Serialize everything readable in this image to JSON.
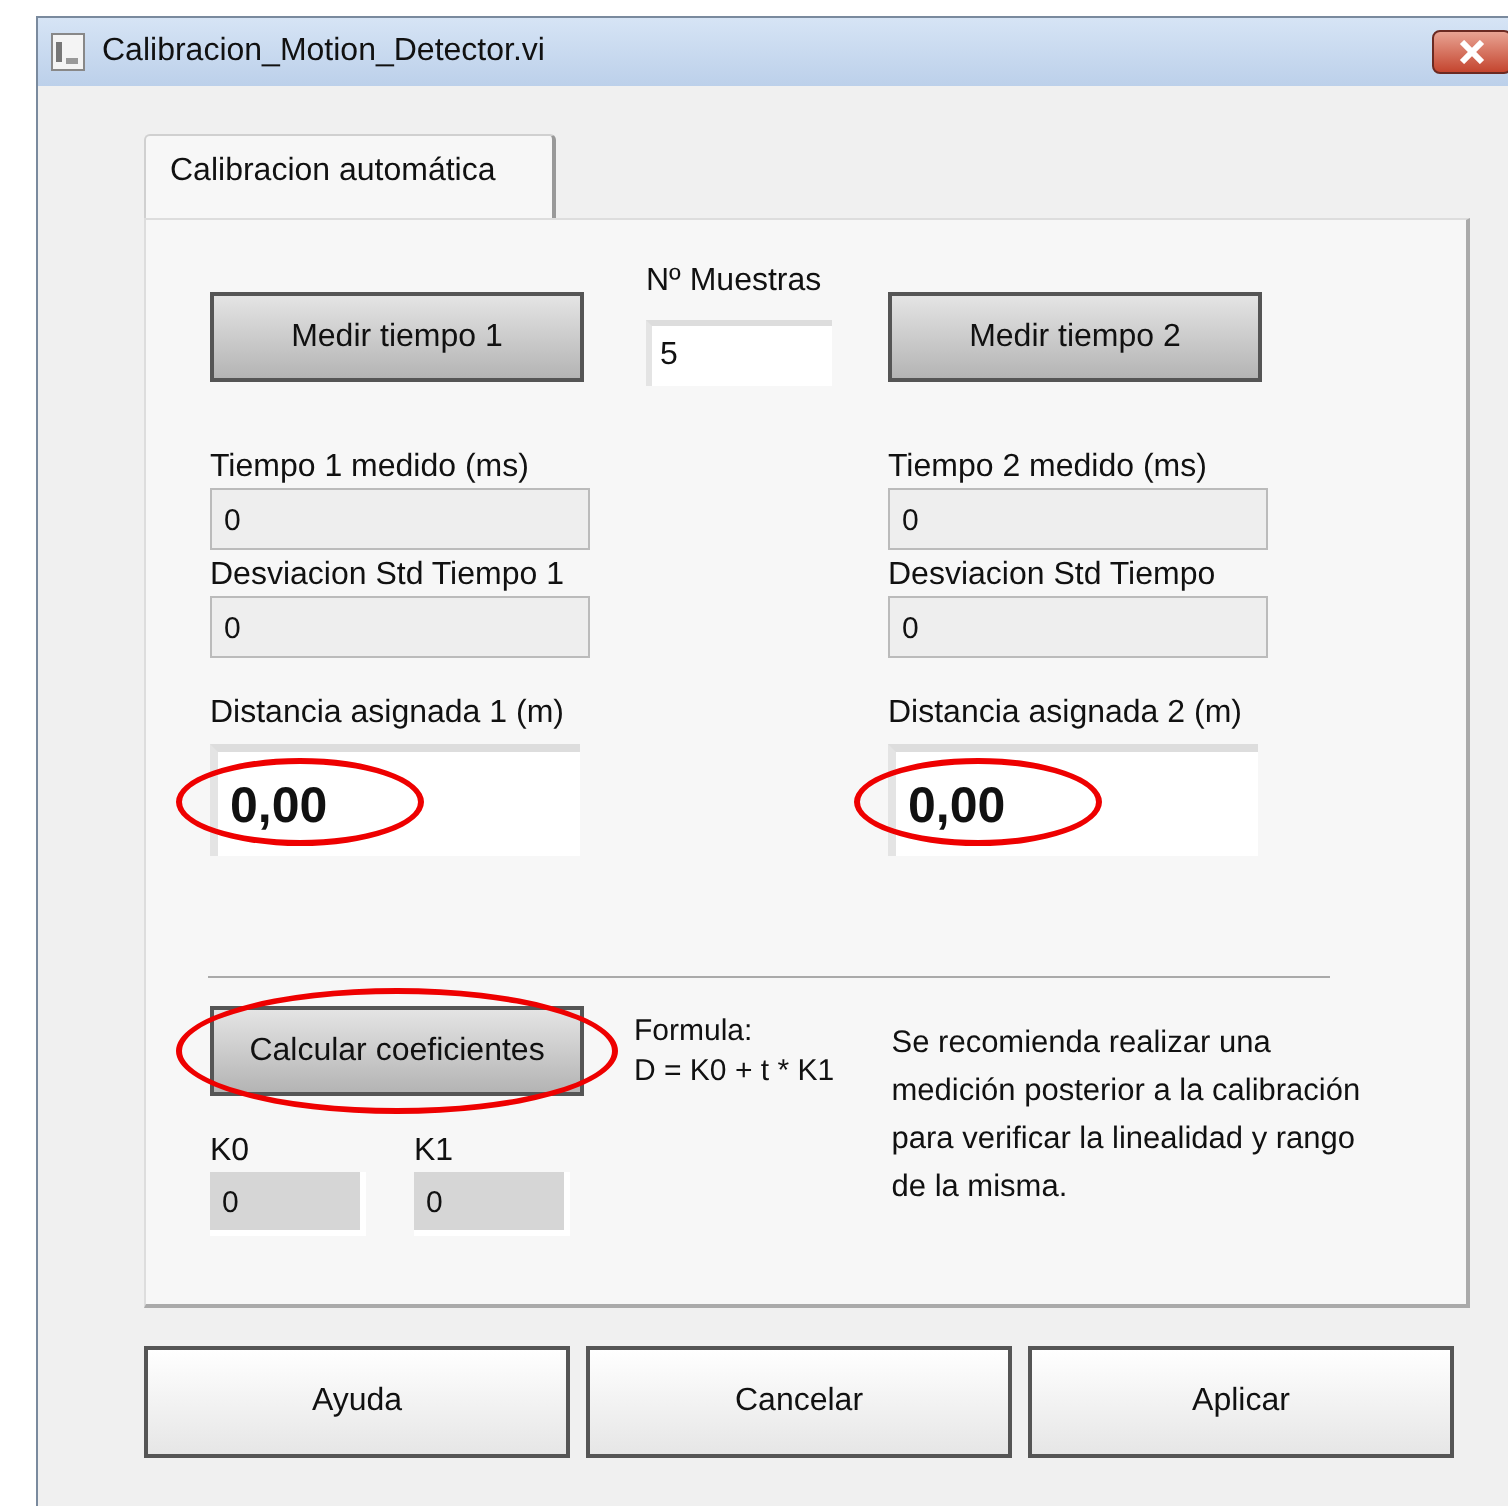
{
  "window": {
    "title": "Calibracion_Motion_Detector.vi"
  },
  "tabs": [
    {
      "label": "Calibracion automática",
      "selected": true
    }
  ],
  "sample_count": {
    "label": "Nº Muestras",
    "value": "5"
  },
  "columns": [
    {
      "button": "Medir tiempo 1",
      "fields": [
        {
          "label": "Tiempo 1 medido (ms)",
          "value": "0"
        },
        {
          "label": "Desviacion Std Tiempo 1",
          "value": "0"
        }
      ],
      "distance": {
        "label": "Distancia asignada 1 (m)",
        "value": "0,00",
        "circled": true
      }
    },
    {
      "button": "Medir tiempo 2",
      "fields": [
        {
          "label": "Tiempo 2 medido (ms)",
          "value": "0"
        },
        {
          "label": "Desviacion Std Tiempo",
          "value": "0"
        }
      ],
      "distance": {
        "label": "Distancia asignada 2 (m)",
        "value": "0,00",
        "circled": true
      }
    }
  ],
  "calculate": {
    "button": "Calcular coeficientes",
    "circled": true
  },
  "formula": [
    "Formula:",
    "D = K0 + t * K1"
  ],
  "coefficients": [
    {
      "label": "K0",
      "value": "0"
    },
    {
      "label": "K1",
      "value": "0"
    }
  ],
  "note_lines": [
    "Se recomienda realizar una",
    "medición posterior a la calibración",
    "para verificar la linealidad y rango",
    "de la misma."
  ],
  "buttons": [
    "Ayuda",
    "Cancelar",
    "Aplicar"
  ]
}
